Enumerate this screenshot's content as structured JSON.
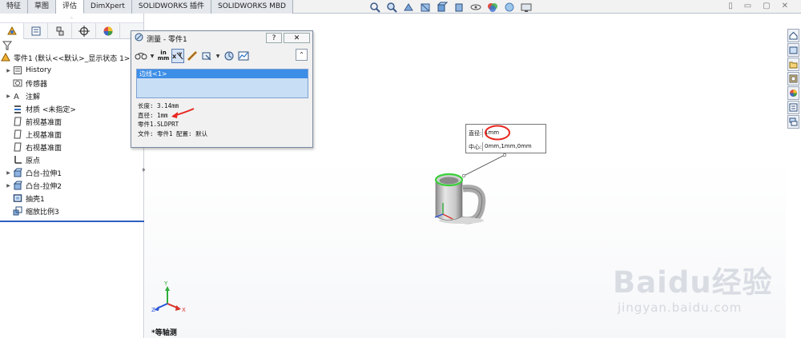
{
  "tabs": [
    "特征",
    "草图",
    "评估",
    "DimXpert",
    "SOLIDWORKS 插件",
    "SOLIDWORKS MBD"
  ],
  "active_tab_index": 2,
  "heads_up_icons": [
    "zoom-to-fit-icon",
    "zoom-area-icon",
    "previous-view-icon",
    "section-view-icon",
    "view-orientation-icon",
    "display-style-icon",
    "hide-show-icon",
    "edit-appearance-icon",
    "apply-scene-icon",
    "view-settings-icon"
  ],
  "window_controls": [
    "▯",
    "▭",
    "▢",
    "✕"
  ],
  "left_panel": {
    "grip": "◦",
    "tabs": [
      "feature-manager-icon",
      "property-manager-icon",
      "configuration-manager-icon",
      "dimxpert-manager-icon",
      "display-manager-icon"
    ],
    "part_label": "零件1  (默认<<默认>_显示状态 1>)",
    "tree": [
      {
        "label": "History",
        "icon": "history-icon",
        "expandable": true
      },
      {
        "label": "传感器",
        "icon": "sensor-icon",
        "expandable": false
      },
      {
        "label": "注解",
        "icon": "annotation-icon",
        "expandable": true
      },
      {
        "label": "材质 <未指定>",
        "icon": "material-icon",
        "expandable": false
      },
      {
        "label": "前视基准面",
        "icon": "plane-icon",
        "expandable": false
      },
      {
        "label": "上视基准面",
        "icon": "plane-icon",
        "expandable": false
      },
      {
        "label": "右视基准面",
        "icon": "plane-icon",
        "expandable": false
      },
      {
        "label": "原点",
        "icon": "origin-icon",
        "expandable": false
      },
      {
        "label": "凸台-拉伸1",
        "icon": "extrude-icon",
        "expandable": true
      },
      {
        "label": "凸台-拉伸2",
        "icon": "extrude-icon",
        "expandable": true
      },
      {
        "label": "抽壳1",
        "icon": "shell-icon",
        "expandable": false
      },
      {
        "label": "缩放比例3",
        "icon": "scale-icon",
        "expandable": false
      }
    ]
  },
  "measure_dialog": {
    "title": "测量 - 零件1",
    "help": "?",
    "close": "✕",
    "units_label_top": "in",
    "units_label_bottom": "mm",
    "collapse": "⌃",
    "selection": "边线<1>",
    "info": {
      "length": "长度: 3.14mm",
      "diameter": "直径: 1mm",
      "part": "零件1.SLDPRT",
      "file": "文件: 零件1 配置: 默认"
    },
    "annotation_color": "#e8261f"
  },
  "callout": {
    "diameter_key": "直径:",
    "diameter_value": "1mm",
    "center_key": "中心:",
    "center_value": "0mm,1mm,0mm"
  },
  "triad_axes": {
    "x": "X",
    "y": "Y",
    "z": "Z"
  },
  "view_label": "*等轴测",
  "taskpane_icons": [
    "home-icon",
    "design-library-icon",
    "file-explorer-icon",
    "view-palette-icon",
    "appearances-icon",
    "custom-properties-icon",
    "forum-icon"
  ],
  "colors": {
    "accent": "#2f5fbf",
    "selected_edge": "#3ad03a",
    "highlight": "#e8261f"
  },
  "watermark": {
    "brand": "Baidu经验",
    "url": "jingyan.baidu.com"
  }
}
